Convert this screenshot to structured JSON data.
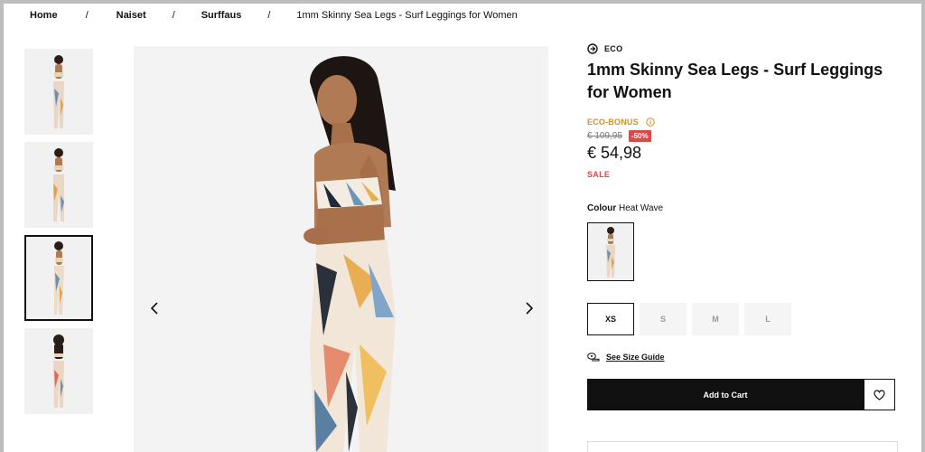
{
  "breadcrumb": {
    "items": [
      "Home",
      "Naiset",
      "Surffaus"
    ],
    "separator": "/",
    "current": "1mm Skinny Sea Legs - Surf Leggings for Women"
  },
  "gallery": {
    "thumbnail_icons": [
      "model-front-icon",
      "model-front-alt-icon",
      "model-side-icon",
      "model-back-icon"
    ],
    "selected_index": 2
  },
  "product": {
    "eco_label": "ECO",
    "title": "1mm Skinny Sea Legs - Surf Leggings for Women",
    "eco_bonus": "ECO-BONUS",
    "old_price": "€ 109,95",
    "discount": "-50%",
    "price": "€ 54,98",
    "sale_label": "SALE",
    "colour_label": "Colour",
    "colour_value": "Heat Wave",
    "sizes": [
      {
        "label": "XS",
        "selected": true
      },
      {
        "label": "S",
        "selected": false
      },
      {
        "label": "M",
        "selected": false
      },
      {
        "label": "L",
        "selected": false
      }
    ],
    "size_guide": "See Size Guide",
    "add_to_cart": "Add to Cart"
  },
  "colors": {
    "accent_gold": "#c9922a",
    "sale_red": "#d94a4a",
    "button_black": "#111111"
  }
}
